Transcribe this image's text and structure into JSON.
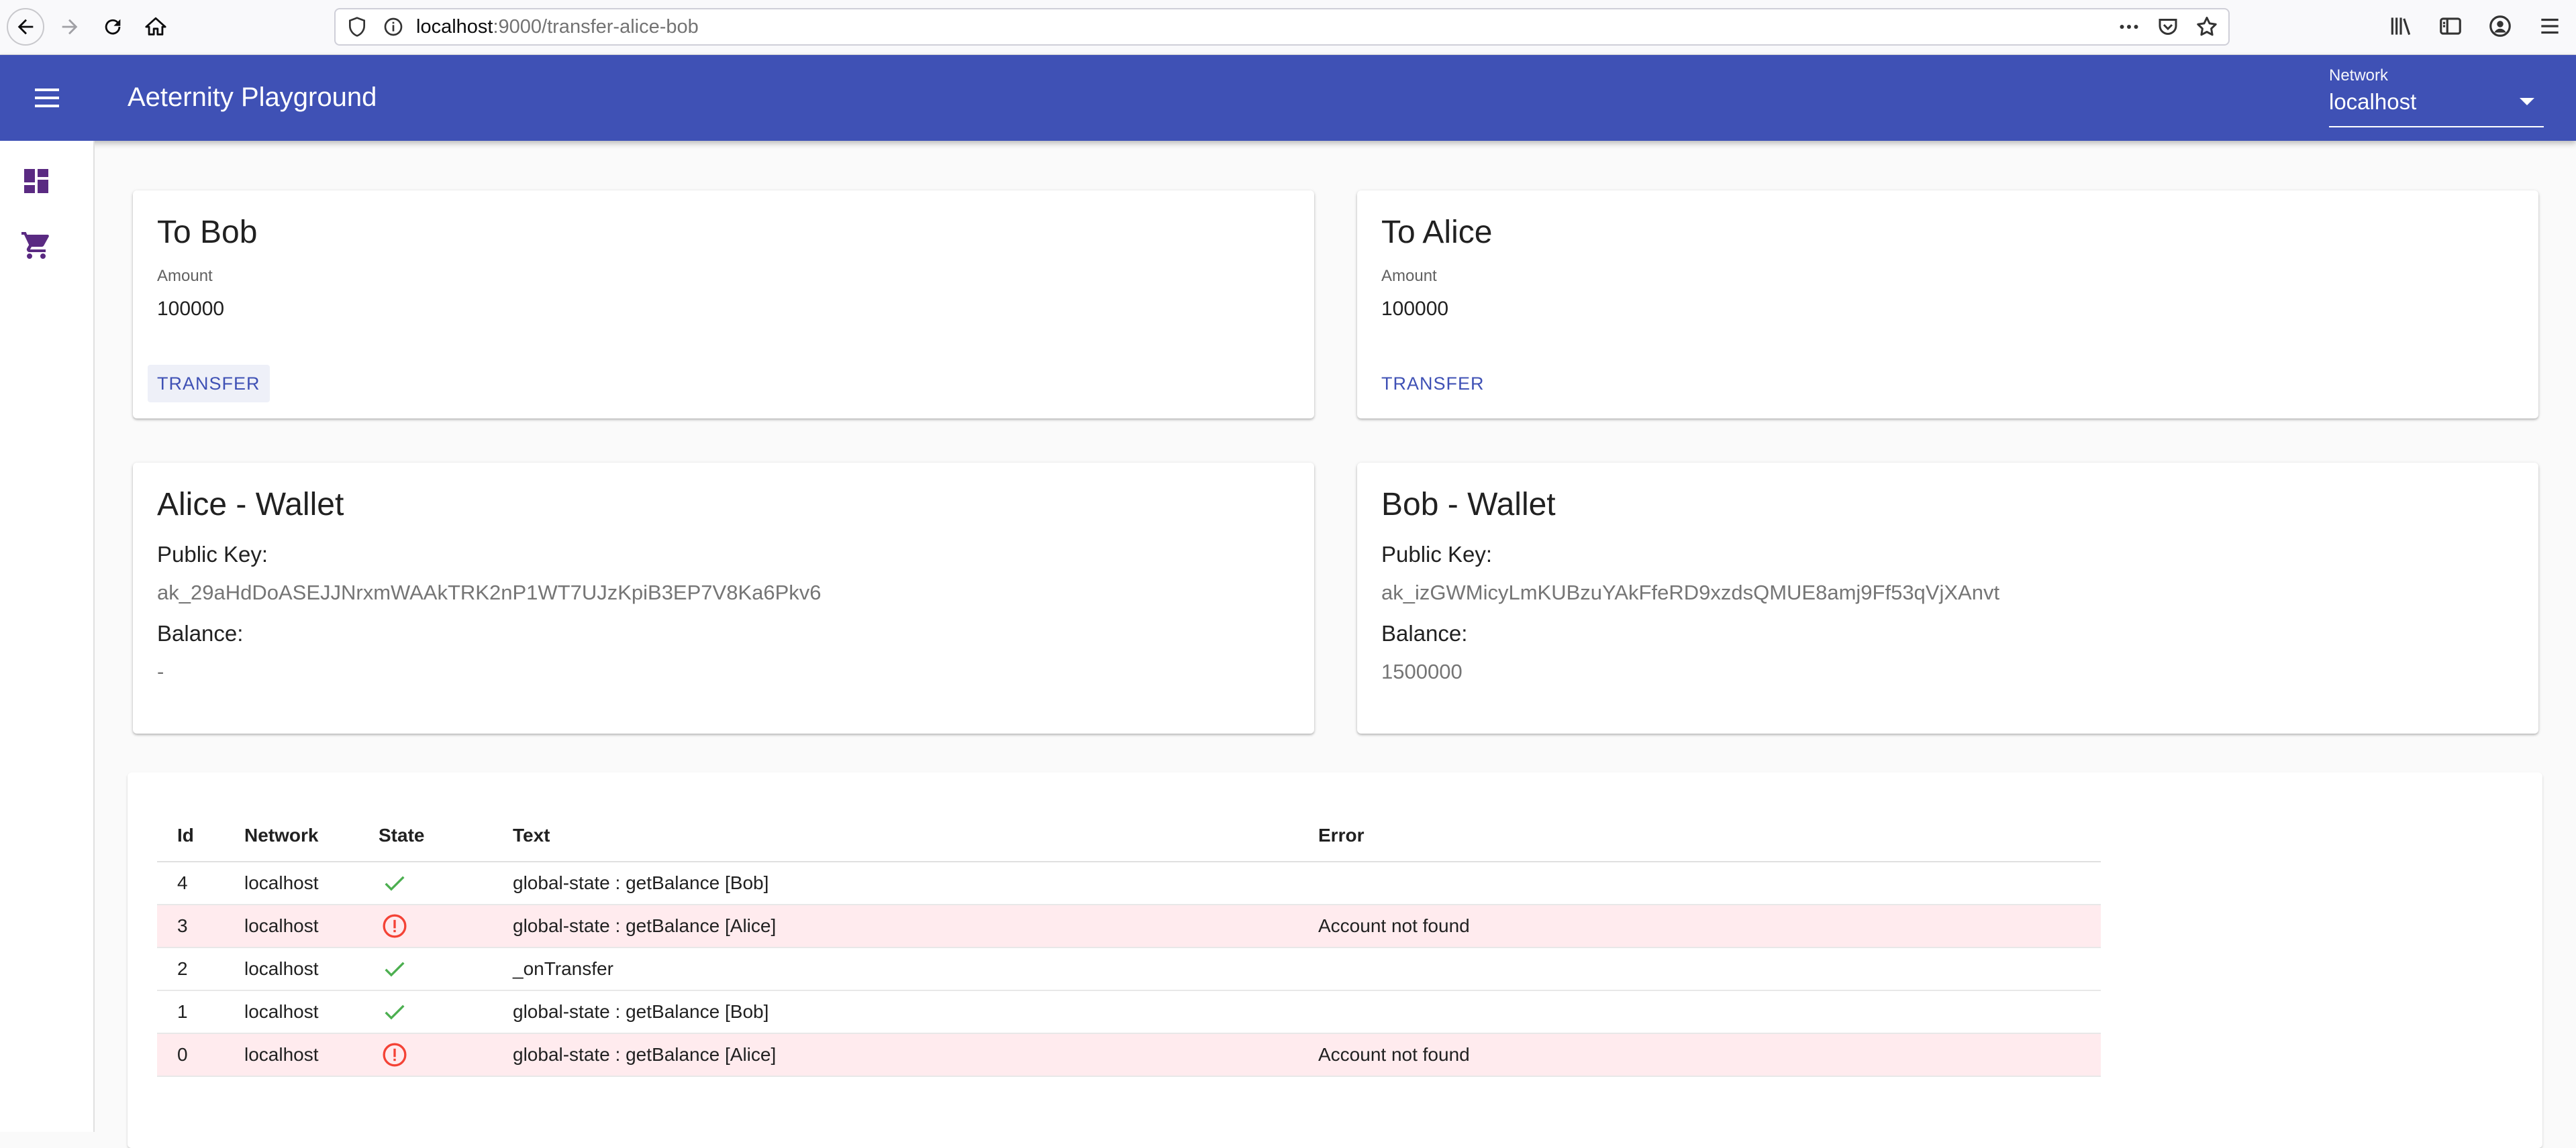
{
  "browser": {
    "url_host": "localhost",
    "url_path": ":9000/transfer-alice-bob"
  },
  "app": {
    "title": "Aeternity Playground",
    "network_label": "Network",
    "network_value": "localhost"
  },
  "cards": {
    "to_bob": {
      "title": "To Bob",
      "amount_label": "Amount",
      "amount_value": "100000",
      "button": "TRANSFER"
    },
    "to_alice": {
      "title": "To Alice",
      "amount_label": "Amount",
      "amount_value": "100000",
      "button": "TRANSFER"
    }
  },
  "wallets": {
    "alice": {
      "title": "Alice - Wallet",
      "key_label": "Public Key:",
      "key": "ak_29aHdDoASEJJNrxmWAAkTRK2nP1WT7UJzKpiB3EP7V8Ka6Pkv6",
      "balance_label": "Balance:",
      "balance": "-"
    },
    "bob": {
      "title": "Bob - Wallet",
      "key_label": "Public Key:",
      "key": "ak_izGWMicyLmKUBzuYAkFfeRD9xzdsQMUE8amj9Ff53qVjXAnvt",
      "balance_label": "Balance:",
      "balance": "1500000"
    }
  },
  "log_table": {
    "headers": {
      "id": "Id",
      "network": "Network",
      "state": "State",
      "text": "Text",
      "error": "Error"
    },
    "rows": [
      {
        "id": "4",
        "network": "localhost",
        "state": "success",
        "text": "global-state : getBalance [Bob]",
        "error": ""
      },
      {
        "id": "3",
        "network": "localhost",
        "state": "error",
        "text": "global-state : getBalance [Alice]",
        "error": "Account not found"
      },
      {
        "id": "2",
        "network": "localhost",
        "state": "success",
        "text": "_onTransfer",
        "error": ""
      },
      {
        "id": "1",
        "network": "localhost",
        "state": "success",
        "text": "global-state : getBalance [Bob]",
        "error": ""
      },
      {
        "id": "0",
        "network": "localhost",
        "state": "error",
        "text": "global-state : getBalance [Alice]",
        "error": "Account not found"
      }
    ]
  },
  "colors": {
    "primary": "#3f51b5",
    "drawer_icon": "#5a2a82",
    "success": "#4caf50",
    "error": "#f44336",
    "error_row": "#ffebee"
  }
}
